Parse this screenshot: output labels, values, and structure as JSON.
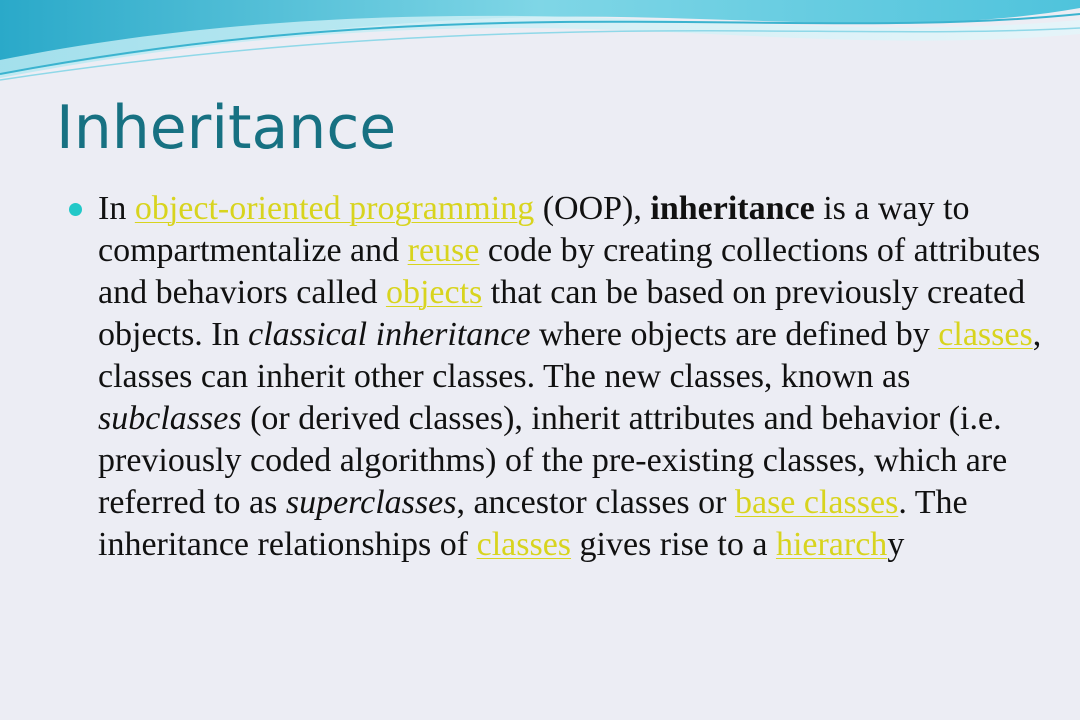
{
  "slide": {
    "title": "Inheritance",
    "colors": {
      "background": "#ecedf4",
      "title": "#177182",
      "link": "#d8d41e",
      "bullet": "#22c8c8",
      "text": "#111111"
    },
    "bullet_icon": "bullet-dot-icon",
    "paragraph": {
      "s01": " In ",
      "l01": "object-oriented programming",
      "s02": " (OOP), ",
      "b01": "inheritance",
      "s03": " is a way to compartmentalize and ",
      "l02": "reuse",
      "s04": " code by creating collections of attributes and behaviors called ",
      "l03": "objects",
      "s05": " that can be based on previously created objects. In ",
      "i01": "classical inheritance",
      "s06": " where objects are defined by ",
      "l04": "classes",
      "s07": ", classes can inherit other classes. The new classes, known as ",
      "i02": "subclasses",
      "s08": " (or derived classes), inherit attributes and behavior (i.e. previously coded algorithms) of the pre-existing classes, which are referred to as ",
      "i03": "superclasses",
      "s09": ", ancestor classes or ",
      "l05": "base classes",
      "s10": ". The inheritance relationships of ",
      "l06": "classes",
      "s11": " gives rise to a ",
      "l07": "hierarch",
      "s12": "y"
    }
  }
}
